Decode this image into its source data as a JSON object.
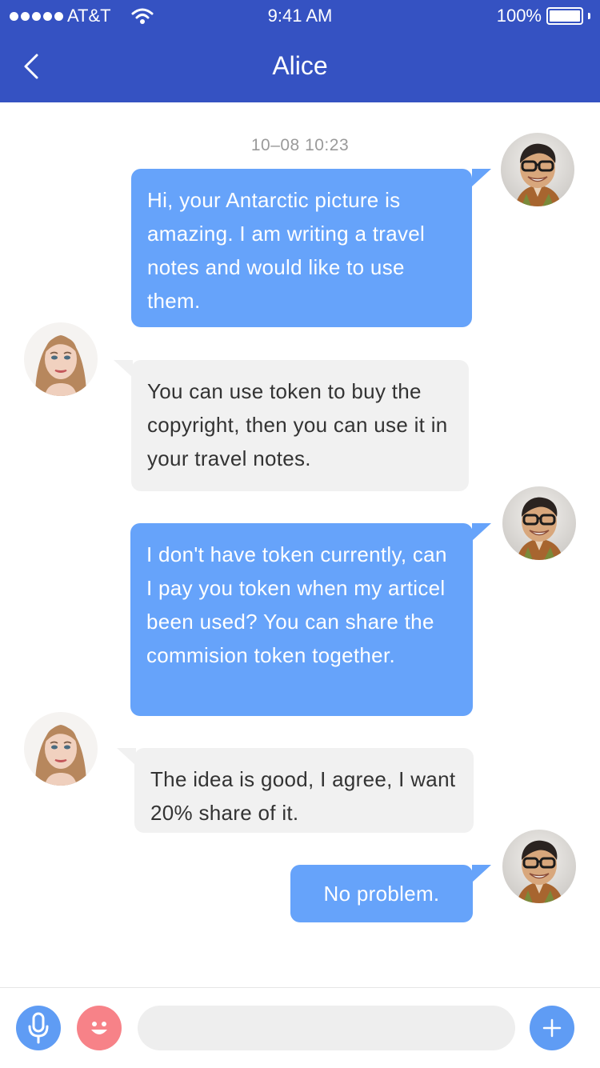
{
  "status_bar": {
    "carrier": "AT&T",
    "time": "9:41 AM",
    "battery": "100%"
  },
  "header": {
    "title": "Alice",
    "back_icon": "chevron-left-icon"
  },
  "conversation": {
    "timestamp": "10–08  10:23",
    "messages": [
      {
        "sender": "me",
        "text": "Hi,  your Antarctic picture is amazing. I am writing a travel notes and would like to use them."
      },
      {
        "sender": "alice",
        "text": "You can use token to buy the copyright, then you can use it in your travel notes."
      },
      {
        "sender": "me",
        "text": "I don't have token currently, can I pay you token when my articel been used? You can share the commision token together."
      },
      {
        "sender": "alice",
        "text": "The idea is good,  I agree, I want 20% share of it."
      },
      {
        "sender": "me",
        "text": "No problem."
      }
    ]
  },
  "composer": {
    "input_value": "",
    "icons": {
      "voice": "microphone-icon",
      "emoji": "smiley-icon",
      "more": "plus-icon"
    }
  },
  "colors": {
    "header": "#3552c2",
    "my_bubble": "#66a3fa",
    "their_bubble": "#f1f1f1",
    "emoji_button": "#f78288",
    "action_button": "#5f9cf4"
  }
}
